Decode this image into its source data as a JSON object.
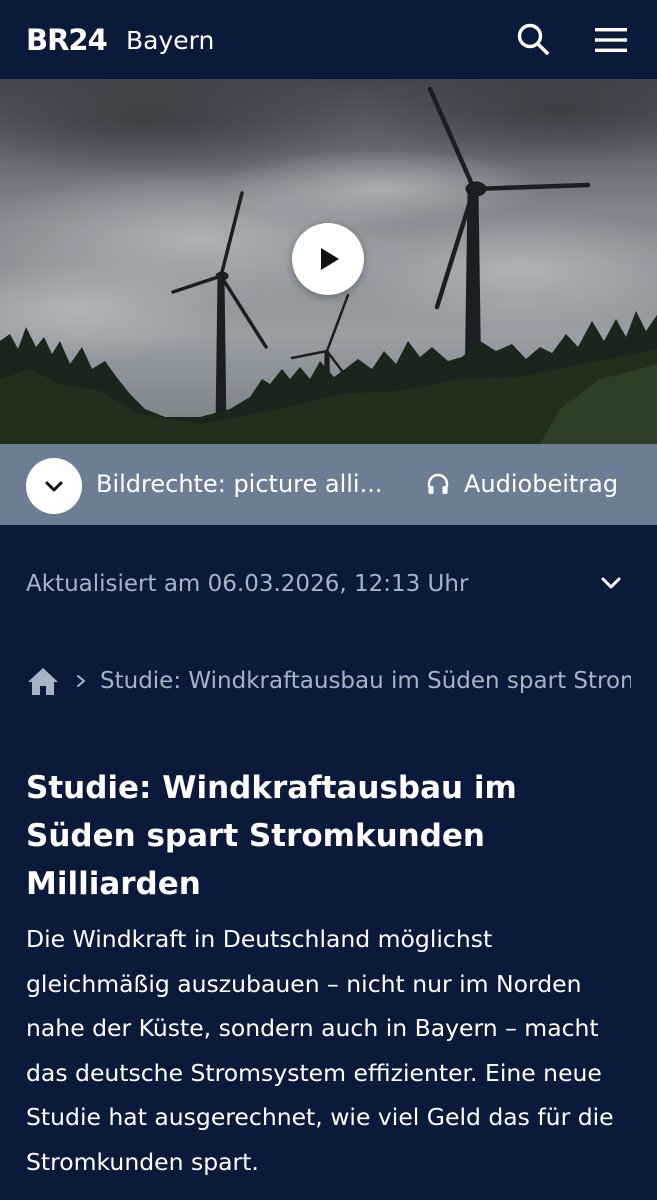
{
  "header": {
    "logo": "BR24",
    "region": "Bayern"
  },
  "hero": {
    "image_alt": "Windräder vor bewölktem Himmel über Nadelwald"
  },
  "caption": {
    "credit": "Bildrechte: picture alli...",
    "audio_label": "Audiobeitrag"
  },
  "meta": {
    "updated": "Aktualisiert am 06.03.2026, 12:13 Uhr"
  },
  "breadcrumb": {
    "current": "Studie: Windkraftausbau im Süden spart Stromkunden Milliarden"
  },
  "article": {
    "title": "Studie: Windkraftausbau im Süden spart Stromkunden Milliarden",
    "teaser": "Die Windkraft in Deutschland möglichst gleichmäßig auszubauen – nicht nur im Norden nahe der Küste, sondern auch in Bayern – macht das deutsche Stromsystem effizienter. Eine neue Studie hat ausgerechnet, wie viel Geld das für die Stromkunden spart."
  },
  "colors": {
    "background": "#0b1a3a",
    "caption_bar": "#6d7d94",
    "muted_text": "#a9b3c6"
  },
  "icons": {
    "search": "search-icon",
    "menu": "hamburger-menu-icon",
    "play": "play-icon",
    "expand": "chevron-down-icon",
    "audio": "headphones-icon",
    "home": "home-icon",
    "breadcrumb_separator": "chevron-right-icon"
  }
}
